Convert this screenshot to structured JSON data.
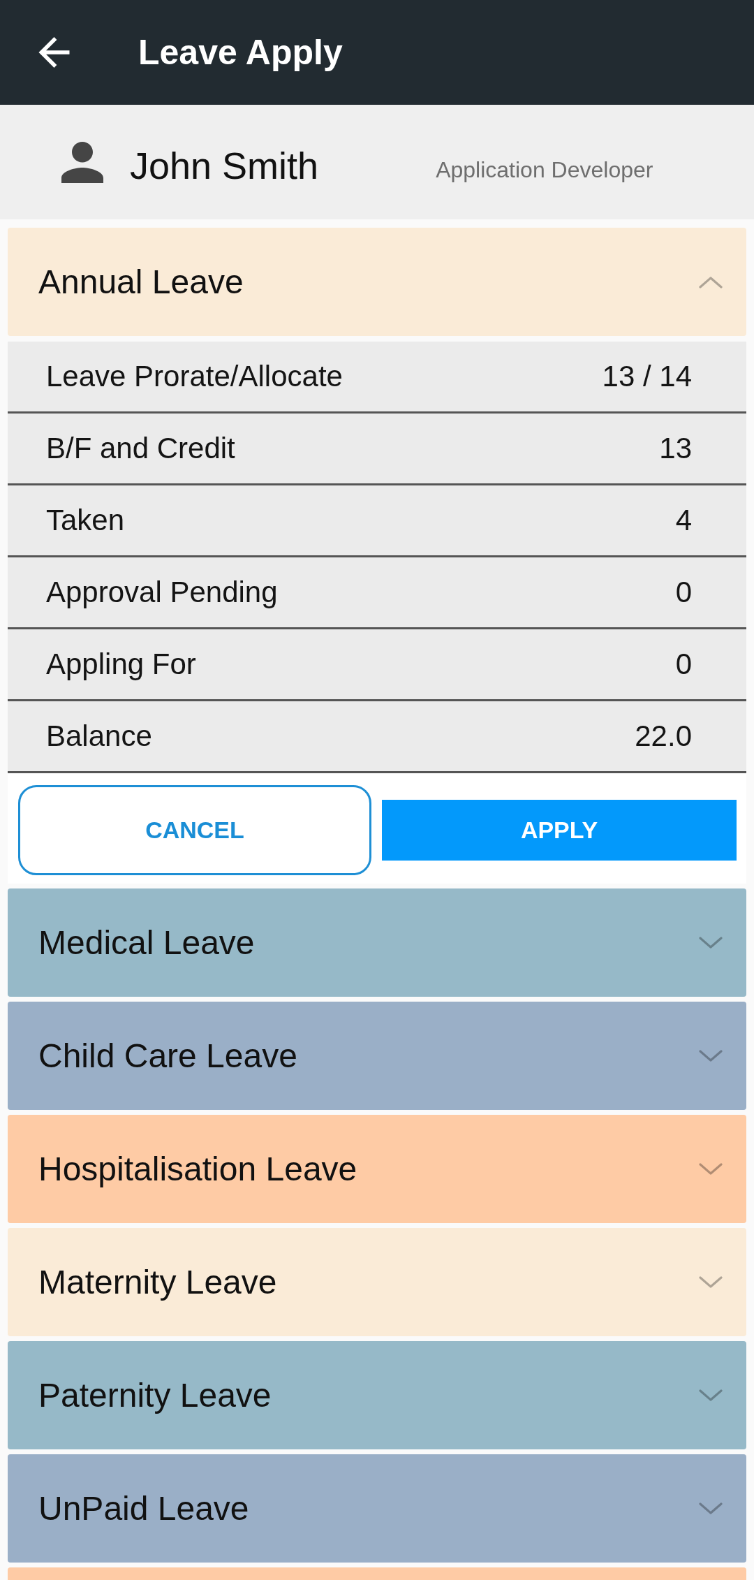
{
  "app_bar": {
    "title": "Leave Apply"
  },
  "profile": {
    "name": "John Smith",
    "role": "Application Developer"
  },
  "leave_types": [
    {
      "title": "Annual Leave",
      "color": "#faebd7",
      "expanded": true,
      "details": [
        {
          "label": "Leave Prorate/Allocate",
          "value": "13 / 14"
        },
        {
          "label": "B/F and Credit",
          "value": "13"
        },
        {
          "label": "Taken",
          "value": "4"
        },
        {
          "label": "Approval Pending",
          "value": "0"
        },
        {
          "label": "Appling For",
          "value": "0"
        },
        {
          "label": "Balance",
          "value": "22.0"
        }
      ],
      "actions": [
        {
          "kind": "outlined",
          "label": "CANCEL"
        },
        {
          "kind": "filled",
          "label": "APPLY"
        }
      ]
    },
    {
      "title": "Medical Leave",
      "color": "#96b9c8",
      "expanded": false
    },
    {
      "title": "Child Care Leave",
      "color": "#9aafc7",
      "expanded": false
    },
    {
      "title": "Hospitalisation Leave",
      "color": "#fecba5",
      "expanded": false
    },
    {
      "title": "Maternity Leave",
      "color": "#faebd7",
      "expanded": false
    },
    {
      "title": "Paternity Leave",
      "color": "#96b9c8",
      "expanded": false
    },
    {
      "title": "UnPaid Leave",
      "color": "#9aafc7",
      "expanded": false
    },
    {
      "color": "#fecba5"
    }
  ]
}
